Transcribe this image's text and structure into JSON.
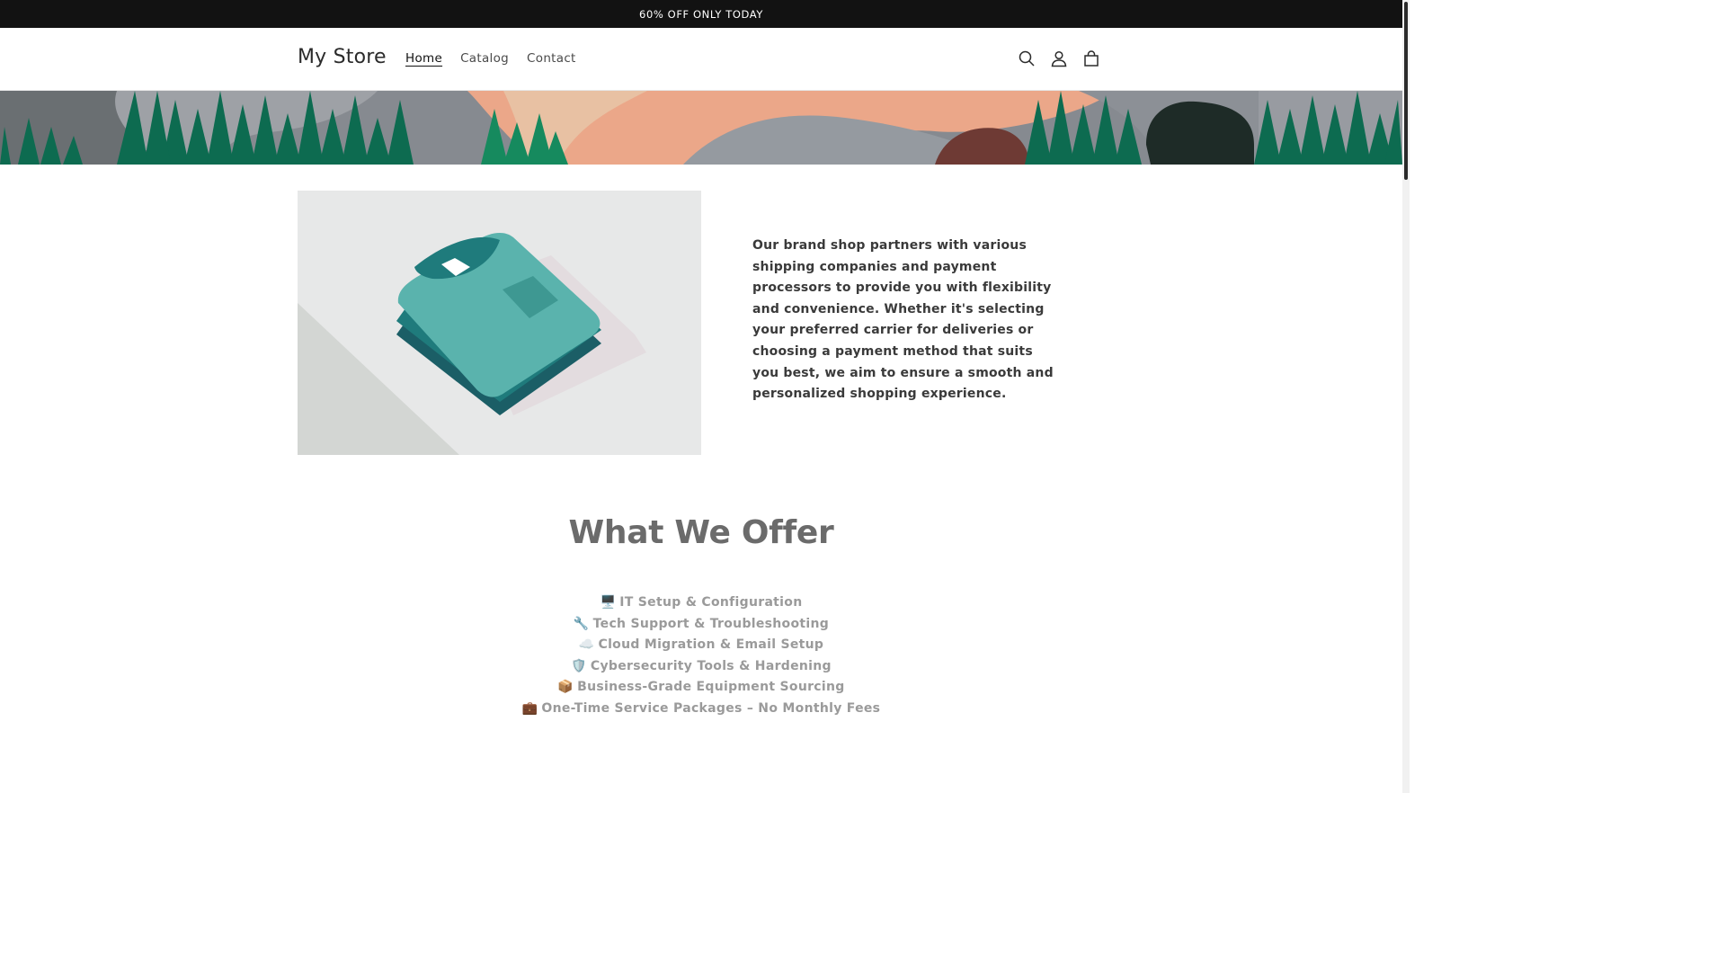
{
  "announcement": {
    "text": "60% OFF ONLY TODAY"
  },
  "header": {
    "logo": "My Store",
    "nav": [
      {
        "label": "Home",
        "active": true
      },
      {
        "label": "Catalog",
        "active": false
      },
      {
        "label": "Contact",
        "active": false
      }
    ],
    "icons": [
      "search-icon",
      "account-icon",
      "cart-icon"
    ]
  },
  "banner": {
    "colors": {
      "gray": "#8a8e93",
      "green": "#0d6b50",
      "peach": "#eba789",
      "rust": "#6e3a34",
      "dark": "#1e2b27"
    }
  },
  "image_with_text": {
    "image": {
      "subject": "t-shirt-stack-illustration",
      "colors": {
        "shirt": "#5ab3ad",
        "shirt_dark": "#1b6e74"
      }
    },
    "text": "Our brand shop partners with various shipping companies and payment processors to provide you with flexibility and convenience. Whether it's selecting your preferred carrier for deliveries or choosing a payment method that suits you best, we aim to ensure a smooth and personalized shopping experience."
  },
  "offer": {
    "title": "What We Offer",
    "items": [
      {
        "emoji": "🖥️",
        "label": "IT Setup & Configuration"
      },
      {
        "emoji": "🔧",
        "label": "Tech Support & Troubleshooting"
      },
      {
        "emoji": "☁️",
        "label": "Cloud Migration & Email Setup"
      },
      {
        "emoji": "🛡️",
        "label": "Cybersecurity Tools & Hardening"
      },
      {
        "emoji": "📦",
        "label": "Business-Grade Equipment Sourcing"
      },
      {
        "emoji": "💼",
        "label": "One-Time Service Packages – No Monthly Fees"
      }
    ]
  }
}
